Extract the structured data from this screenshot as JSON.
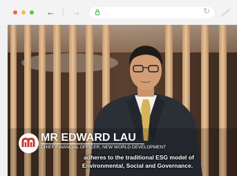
{
  "browser": {
    "back_label": "←",
    "forward_label": "→",
    "reload_label": "↻",
    "url_icon": "lock-icon",
    "extension_icon": "feather-icon"
  },
  "video": {
    "speaker_name": "MR EDWARD LAU",
    "speaker_title": "CHIEF FINANCIAL OFFICER, NEW WORLD DEVELOPMENT",
    "logo_icon": "nwd-logo-icon",
    "subtitle_line1": "adheres to the traditional ESG model of",
    "subtitle_line2": "Environmental, Social and Governance."
  },
  "colors": {
    "close": "#ef5e58",
    "minimize": "#f2bf3a",
    "maximize": "#5fc24f",
    "logo_red": "#c8372d"
  }
}
